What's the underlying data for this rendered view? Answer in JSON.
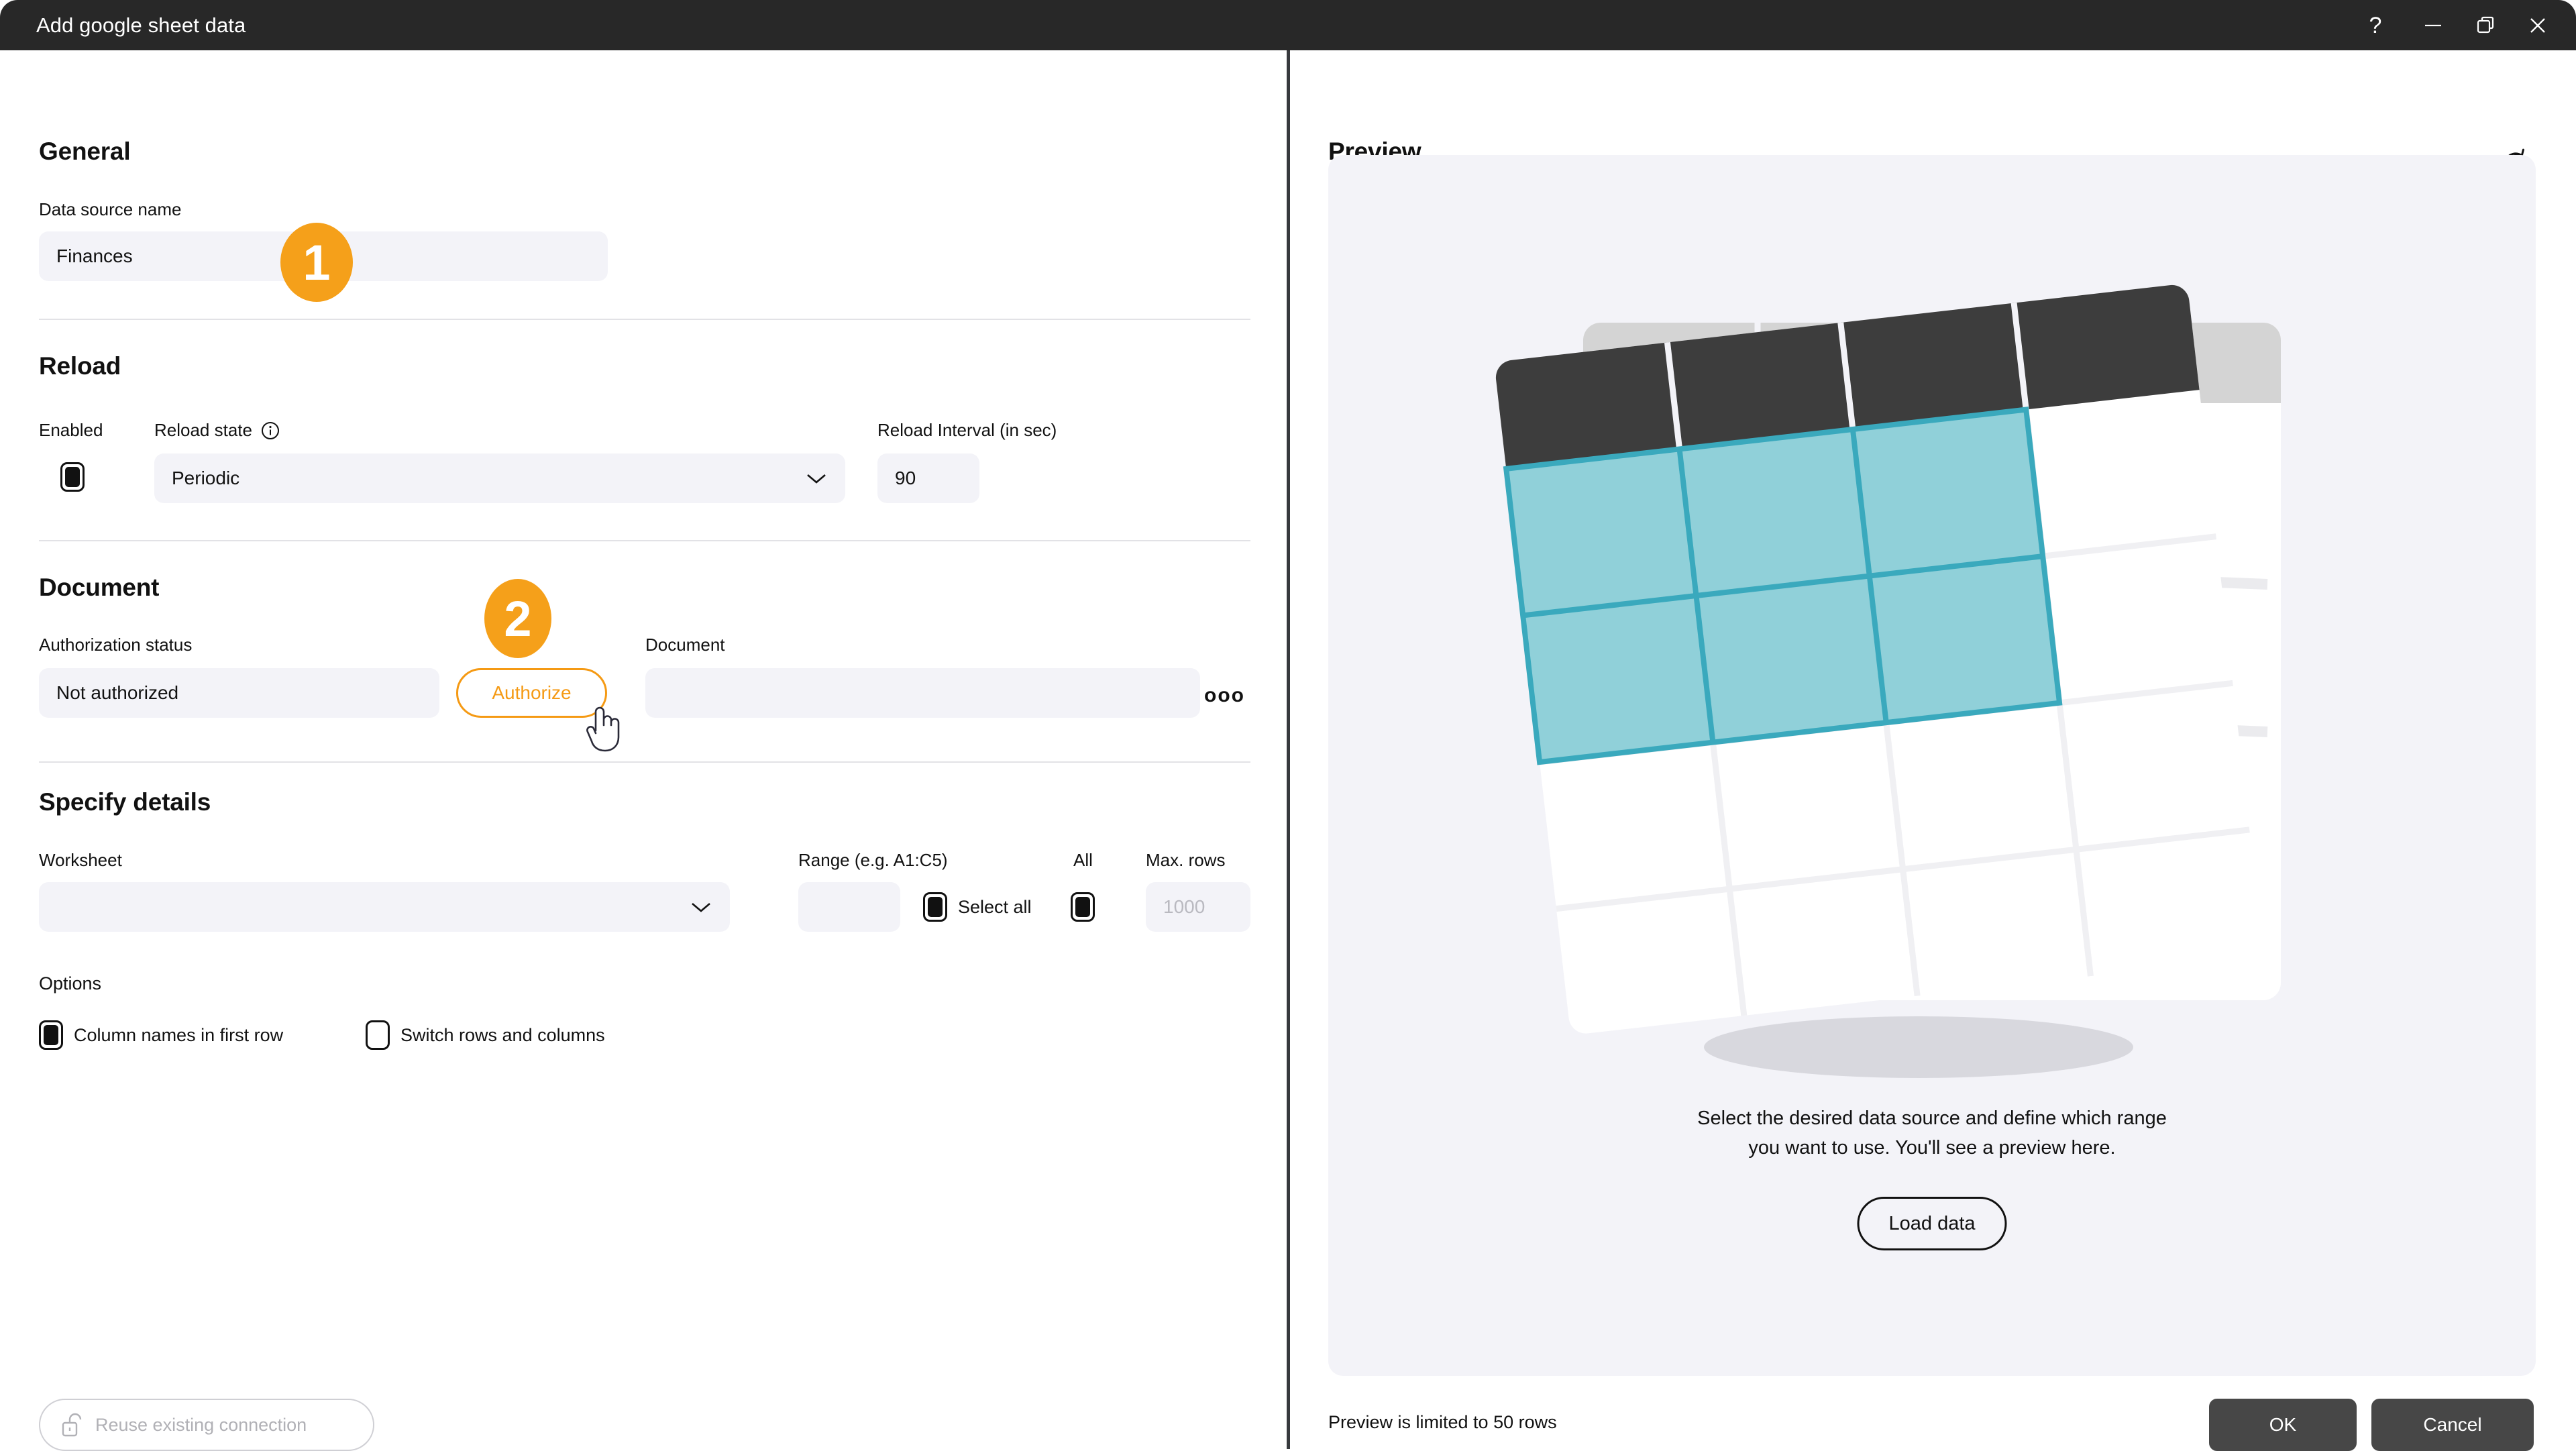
{
  "window": {
    "title": "Add google sheet data",
    "controls": [
      {
        "name": "help",
        "glyph": "?"
      },
      {
        "name": "minimize",
        "glyph": "—"
      },
      {
        "name": "restore",
        "glyph": "❐"
      },
      {
        "name": "close",
        "glyph": "✕"
      }
    ]
  },
  "general": {
    "section_title": "General",
    "data_source_name_label": "Data source name",
    "data_source_name_value": "Finances"
  },
  "reload": {
    "section_title": "Reload",
    "enabled_label": "Enabled",
    "enabled_checked": true,
    "reload_state_label": "Reload state",
    "reload_state_info_icon": "info-icon",
    "reload_state_value": "Periodic",
    "interval_label": "Reload Interval (in sec)",
    "interval_value": "90"
  },
  "document": {
    "section_title": "Document",
    "auth_status_label": "Authorization status",
    "auth_status_value": "Not authorized",
    "authorize_label": "Authorize",
    "document_label": "Document",
    "document_value": "",
    "more_options_glyph": "ooo"
  },
  "specify_details": {
    "section_title": "Specify details",
    "worksheet_label": "Worksheet",
    "worksheet_value": "",
    "range_label": "Range (e.g. A1:C5)",
    "range_value": "",
    "select_all_label": "Select all",
    "select_all_checked": true,
    "all_label": "All",
    "all_checked": true,
    "max_rows_label": "Max. rows",
    "max_rows_placeholder": "1000"
  },
  "options": {
    "section_title": "Options",
    "items": [
      {
        "label": "Column names in first row",
        "checked": true
      },
      {
        "label": "Switch rows and columns",
        "checked": false
      }
    ]
  },
  "footer_left": {
    "reuse_label": "Reuse existing connection",
    "lock_icon": "open-padlock-icon"
  },
  "preview": {
    "title": "Preview",
    "refresh_icon": "refresh-icon",
    "empty_text_line1": "Select the desired data source and define which range",
    "empty_text_line2": "you want to use. You'll see a preview here.",
    "load_data_label": "Load data",
    "limit_note": "Preview is limited to 50 rows",
    "ok_label": "OK",
    "cancel_label": "Cancel"
  },
  "annotations": [
    {
      "number": "1"
    },
    {
      "number": "2"
    }
  ],
  "colors": {
    "accent_orange": "#f5a01a",
    "titlebar": "#282828",
    "input_bg": "#f3f3f8",
    "dark_button": "#474747",
    "teal": "#8acdd7"
  }
}
